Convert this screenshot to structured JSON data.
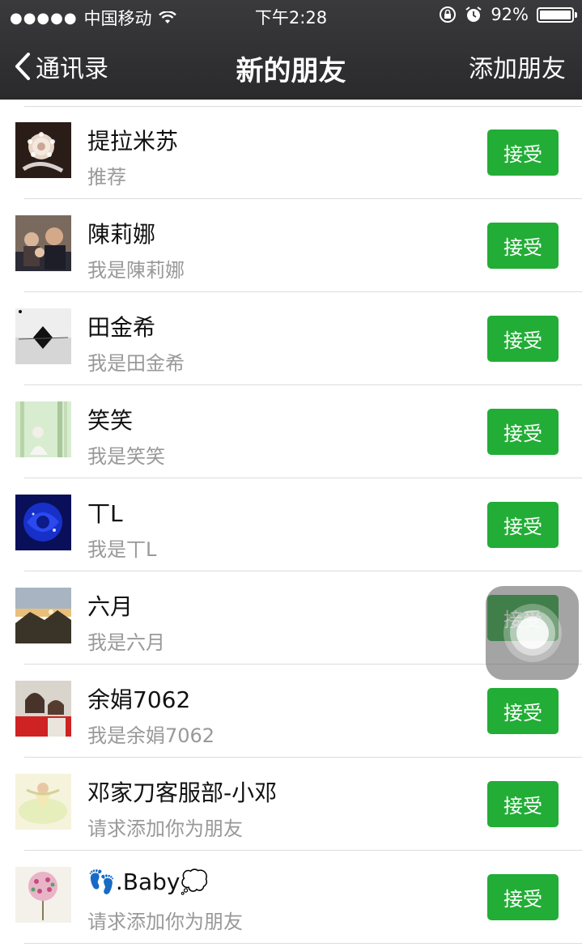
{
  "status_bar": {
    "carrier": "中国移动",
    "time": "下午2:28",
    "battery": "92%",
    "battery_level": 0.92
  },
  "nav": {
    "back_label": "通讯录",
    "title": "新的朋友",
    "add_label": "添加朋友"
  },
  "friends": [
    {
      "name": "提拉米苏",
      "message": "推荐",
      "action": "接受"
    },
    {
      "name": "陳莉娜",
      "message": "我是陳莉娜",
      "action": "接受"
    },
    {
      "name": "田金希",
      "message": "我是田金希",
      "action": "接受"
    },
    {
      "name": "笑笑",
      "message": "我是笑笑",
      "action": "接受"
    },
    {
      "name": "丅L",
      "message": "我是丅L",
      "action": "接受"
    },
    {
      "name": "六月",
      "message": "我是六月",
      "action": "接受"
    },
    {
      "name": "余娟7062",
      "message": "我是余娟7062",
      "action": "接受"
    },
    {
      "name": "邓家刀客服部-小邓",
      "message": "请求添加你为朋友",
      "action": "接受"
    },
    {
      "name": "👣.Baby💭",
      "message": "请求添加你为朋友",
      "action": "接受"
    }
  ],
  "colors": {
    "accept_button": "#22ad36",
    "header_bg": "#2e2e30"
  }
}
